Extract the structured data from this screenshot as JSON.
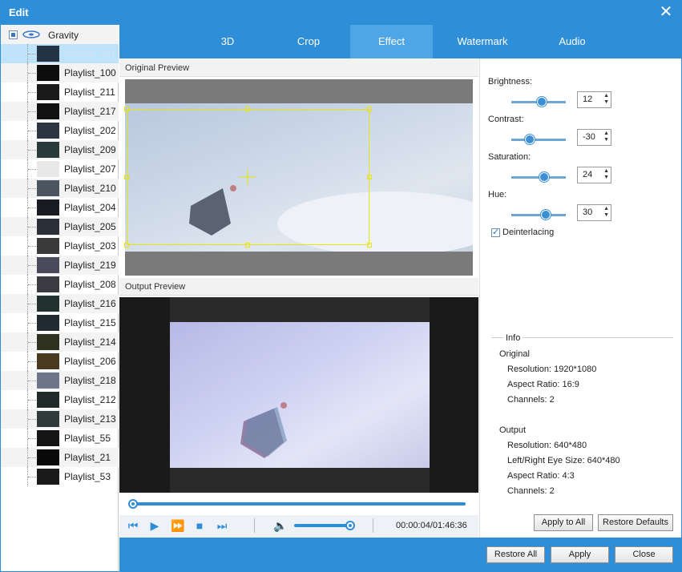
{
  "window": {
    "title": "Edit"
  },
  "sidebar": {
    "root": "Gravity",
    "items": [
      {
        "label": "Playlist_201",
        "selected": true
      },
      {
        "label": "Playlist_100"
      },
      {
        "label": "Playlist_211"
      },
      {
        "label": "Playlist_217"
      },
      {
        "label": "Playlist_202"
      },
      {
        "label": "Playlist_209"
      },
      {
        "label": "Playlist_207"
      },
      {
        "label": "Playlist_210"
      },
      {
        "label": "Playlist_204"
      },
      {
        "label": "Playlist_205"
      },
      {
        "label": "Playlist_203"
      },
      {
        "label": "Playlist_219"
      },
      {
        "label": "Playlist_208"
      },
      {
        "label": "Playlist_216"
      },
      {
        "label": "Playlist_215"
      },
      {
        "label": "Playlist_214"
      },
      {
        "label": "Playlist_206"
      },
      {
        "label": "Playlist_218"
      },
      {
        "label": "Playlist_212"
      },
      {
        "label": "Playlist_213"
      },
      {
        "label": "Playlist_55"
      },
      {
        "label": "Playlist_21"
      },
      {
        "label": "Playlist_53"
      }
    ]
  },
  "tabs": [
    "3D",
    "Crop",
    "Effect",
    "Watermark",
    "Audio"
  ],
  "active_tab": "Effect",
  "preview": {
    "original_label": "Original Preview",
    "output_label": "Output Preview"
  },
  "player": {
    "time": "00:00:04/01:46:36",
    "progress": 0,
    "volume": 1.0
  },
  "effect": {
    "brightness": {
      "label": "Brightness:",
      "value": "12"
    },
    "contrast": {
      "label": "Contrast:",
      "value": "-30"
    },
    "saturation": {
      "label": "Saturation:",
      "value": "24"
    },
    "hue": {
      "label": "Hue:",
      "value": "30"
    },
    "deinterlacing": {
      "label": "Deinterlacing",
      "checked": true
    }
  },
  "info": {
    "title": "Info",
    "original": {
      "heading": "Original",
      "resolution": "Resolution: 1920*1080",
      "aspect": "Aspect Ratio: 16:9",
      "channels": "Channels: 2"
    },
    "output": {
      "heading": "Output",
      "resolution": "Resolution: 640*480",
      "eye": "Left/Right Eye Size: 640*480",
      "aspect": "Aspect Ratio: 4:3",
      "channels": "Channels: 2"
    }
  },
  "buttons": {
    "apply_all": "Apply to All",
    "restore_defaults": "Restore Defaults",
    "restore_all": "Restore All",
    "apply": "Apply",
    "close": "Close"
  },
  "colors": {
    "accent": "#2f8ed8",
    "active_tab": "#4fa6e6",
    "crop_frame": "#e6e600"
  }
}
